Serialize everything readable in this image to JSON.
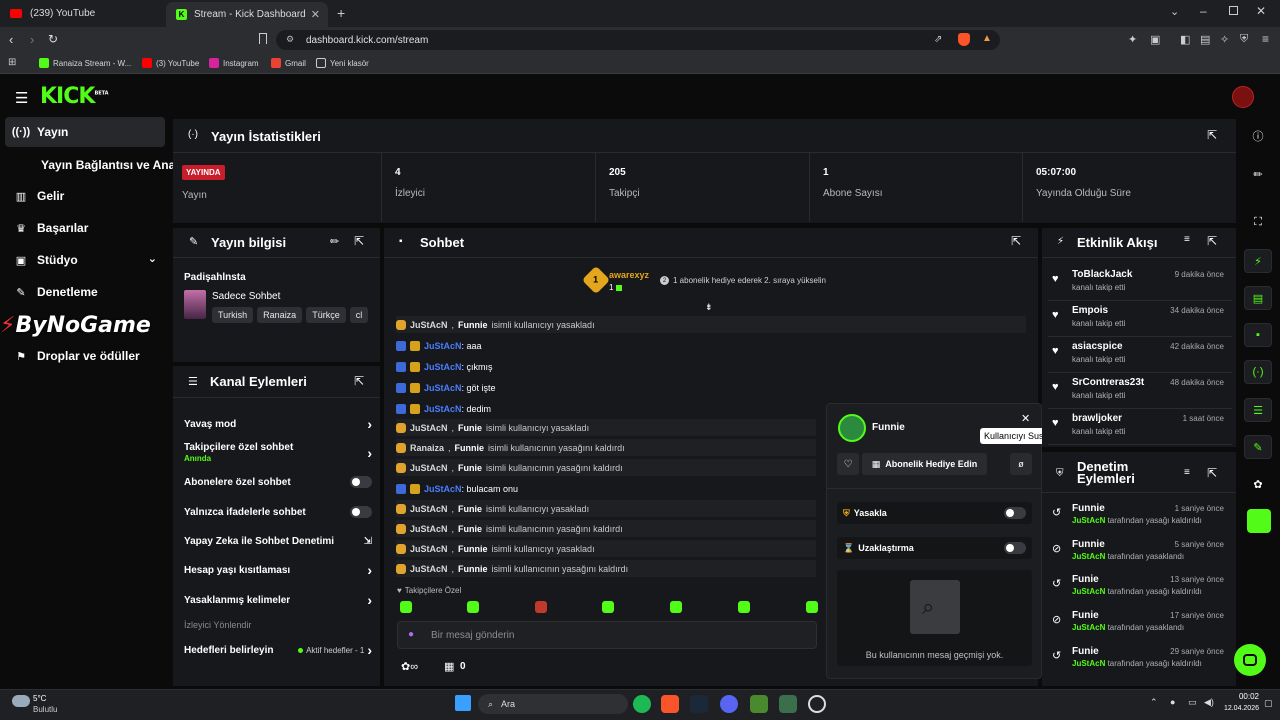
{
  "browser": {
    "tabs": [
      {
        "label": "(239) YouTube"
      },
      {
        "label": "Stream - Kick Dashboard"
      }
    ],
    "url": "dashboard.kick.com/stream",
    "bookmarks": [
      {
        "label": "Ranaiza Stream - W..."
      },
      {
        "label": "(3) YouTube"
      },
      {
        "label": "Instagram"
      },
      {
        "label": "Gmail"
      },
      {
        "label": "Yeni klasör"
      }
    ]
  },
  "brand": {
    "logo": "KICK",
    "beta": "BETA",
    "accent": "#53fc18"
  },
  "sidebar": {
    "items": [
      {
        "label": "Yayın",
        "icon": "broadcast-icon"
      },
      {
        "label": "Yayın Bağlantısı ve Anahtarı",
        "icon": ""
      },
      {
        "label": "Gelir",
        "icon": "chart-icon"
      },
      {
        "label": "Başarılar",
        "icon": "trophy-icon"
      },
      {
        "label": "Stüdyo",
        "icon": "studio-icon"
      },
      {
        "label": "Denetleme",
        "icon": "wrench-icon"
      },
      {
        "label": "",
        "icon": "overlay-icon"
      },
      {
        "label": "Droplar ve ödüller",
        "icon": "gift-icon"
      }
    ],
    "watermark": "ByNoGame"
  },
  "stats": {
    "title": "Yayın İstatistikleri",
    "live_badge": "YAYINDA",
    "live_label": "Yayın",
    "cells": [
      {
        "value": "4",
        "label": "İzleyici"
      },
      {
        "value": "205",
        "label": "Takipçi"
      },
      {
        "value": "1",
        "label": "Abone Sayısı"
      },
      {
        "value": "05:07:00",
        "label": "Yayında Olduğu Süre"
      }
    ]
  },
  "stream_info": {
    "title": "Yayın bilgisi",
    "streamer": "Padişahlnsta",
    "category": "Sadece Sohbet",
    "tags": [
      "Turkish",
      "Ranaiza",
      "Türkçe",
      "cl"
    ]
  },
  "channel_actions": {
    "title": "Kanal Eylemleri",
    "rows": [
      {
        "label": "Yavaş mod",
        "control": "chevron"
      },
      {
        "label": "Takipçilere özel sohbet",
        "sub": "Anında",
        "control": "chevron"
      },
      {
        "label": "Abonelere özel sohbet",
        "control": "toggle"
      },
      {
        "label": "Yalnızca ifadelerle sohbet",
        "control": "toggle"
      },
      {
        "label": "Yapay Zeka ile Sohbet Denetimi",
        "control": "external"
      },
      {
        "label": "Hesap yaşı kısıtlaması",
        "control": "chevron"
      },
      {
        "label": "Yasaklanmış kelimeler",
        "control": "chevron"
      }
    ],
    "section_label": "İzleyici Yönlendir",
    "goals": {
      "label": "Hedefleri belirleyin",
      "status": "Aktif hedefler - 1"
    }
  },
  "chat": {
    "title": "Sohbet",
    "top_gifter": {
      "rank": "1",
      "name": "awarexyz",
      "count": "1",
      "note": "1 abonelik hediye ederek 2. sıraya yükselin"
    },
    "messages": [
      {
        "type": "sys",
        "user": "JuStAcN",
        "target": "Funnie",
        "text": "isimli kullanıcıyı yasakladı"
      },
      {
        "type": "msg",
        "user": "JuStAcN",
        "text": ": aaa"
      },
      {
        "type": "msg",
        "user": "JuStAcN",
        "text": ": çıkmış"
      },
      {
        "type": "msg",
        "user": "JuStAcN",
        "text": ": göt işte"
      },
      {
        "type": "msg",
        "user": "JuStAcN",
        "text": ": dedim"
      },
      {
        "type": "sys",
        "user": "JuStAcN",
        "target": "Funie",
        "text": "isimli kullanıcıyı yasakladı"
      },
      {
        "type": "sys",
        "user": "Ranaiza",
        "target": "Funnie",
        "text": "isimli kullanıcının yasağını kaldırdı"
      },
      {
        "type": "sys",
        "user": "JuStAcN",
        "target": "Funie",
        "text": "isimli kullanıcının yasağını kaldırdı"
      },
      {
        "type": "msg",
        "user": "JuStAcN",
        "text": ": bulacam onu"
      },
      {
        "type": "sys",
        "user": "JuStAcN",
        "target": "Funie",
        "text": "isimli kullanıcıyı yasakladı"
      },
      {
        "type": "sys",
        "user": "JuStAcN",
        "target": "Funie",
        "text": "isimli kullanıcının yasağını kaldırdı"
      },
      {
        "type": "sys",
        "user": "JuStAcN",
        "target": "Funnie",
        "text": "isimli kullanıcıyı yasakladı"
      },
      {
        "type": "sys",
        "user": "JuStAcN",
        "target": "Funnie",
        "text": "isimli kullanıcının yasağını kaldırdı"
      }
    ],
    "followers_only_label": "Takipçilere Özel",
    "input_placeholder": "Bir mesaj gönderin",
    "points": "0"
  },
  "user_card": {
    "name": "Funnie",
    "gift_button": "Abonelik Hediye Edin",
    "tooltip": "Kullanıcıyı Sustur",
    "ban_label": "Yasakla",
    "timeout_label": "Uzaklaştırma",
    "empty_history": "Bu kullanıcının mesaj geçmişi yok."
  },
  "activity": {
    "title": "Etkinlik Akışı",
    "events": [
      {
        "name": "ToBlackJack",
        "sub": "kanalı takip etti",
        "time": "9 dakika önce"
      },
      {
        "name": "Empois",
        "sub": "kanalı takip etti",
        "time": "34 dakika önce"
      },
      {
        "name": "asiacspice",
        "sub": "kanalı takip etti",
        "time": "42 dakika önce"
      },
      {
        "name": "SrContreras23t",
        "sub": "kanalı takip etti",
        "time": "48 dakika önce"
      },
      {
        "name": "brawljoker",
        "sub": "kanalı takip etti",
        "time": "1 saat önce"
      }
    ]
  },
  "moderation": {
    "title_line1": "Denetim",
    "title_line2": "Eylemleri",
    "actions": [
      {
        "name": "Funnie",
        "by": "JuStAcN",
        "action": "tarafından yasağı kaldırıldı",
        "time": "1 saniye önce",
        "icon": "undo-icon"
      },
      {
        "name": "Funnie",
        "by": "JuStAcN",
        "action": "tarafından yasaklandı",
        "time": "5 saniye önce",
        "icon": "ban-icon"
      },
      {
        "name": "Funie",
        "by": "JuStAcN",
        "action": "tarafından yasağı kaldırıldı",
        "time": "13 saniye önce",
        "icon": "undo-icon"
      },
      {
        "name": "Funie",
        "by": "JuStAcN",
        "action": "tarafından yasaklandı",
        "time": "17 saniye önce",
        "icon": "ban-icon"
      },
      {
        "name": "Funie",
        "by": "JuStAcN",
        "action": "tarafından yasağı kaldırıldı",
        "time": "29 saniye önce",
        "icon": "undo-icon"
      }
    ]
  },
  "taskbar": {
    "weather_temp": "5°C",
    "weather_desc": "Bulutlu",
    "search": "Ara",
    "time": "00:02",
    "date": "12.04.2026"
  }
}
